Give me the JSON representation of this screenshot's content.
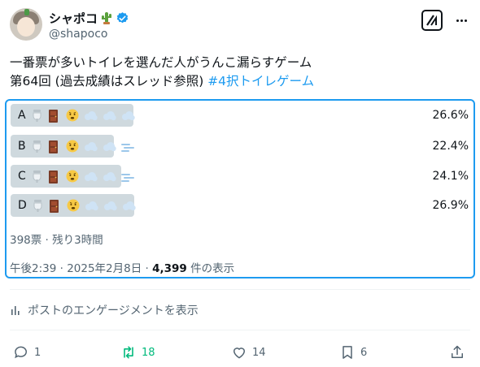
{
  "author": {
    "display_name": "シャポコ",
    "handle": "@shapoco",
    "cactus_icon": "cactus-emoji",
    "verified_icon": "verified-badge-icon"
  },
  "tweet": {
    "line1": "一番票が多いトイレを選んだ人がうんこ漏らすゲーム",
    "line2_text": "第64回 (過去成績はスレッド参照) ",
    "hashtag": "#4択トイレゲーム"
  },
  "poll": {
    "options": [
      {
        "letter": "A",
        "percent": "26.6%",
        "fraction": 0.266,
        "trail": "wind"
      },
      {
        "letter": "B",
        "percent": "22.4%",
        "fraction": 0.224,
        "trail": "wind-with-dash"
      },
      {
        "letter": "C",
        "percent": "24.1%",
        "fraction": 0.241,
        "trail": "wind-with-dash"
      },
      {
        "letter": "D",
        "percent": "26.9%",
        "fraction": 0.269,
        "trail": "wind"
      }
    ],
    "status": "398票 · 残り3時間"
  },
  "post_meta": {
    "time": "午後2:39 · 2025年2月8日 · ",
    "views": "4,399",
    "views_suffix": " 件の表示"
  },
  "engagement_link": "ポストのエンゲージメントを表示",
  "actions": {
    "replies": "1",
    "reposts": "18",
    "likes": "14",
    "bookmarks": "6"
  },
  "colors": {
    "accent": "#1d9bf0",
    "repost_green": "#00ba7c",
    "muted_text": "#536471",
    "bar_fill": "#cfd9de"
  }
}
